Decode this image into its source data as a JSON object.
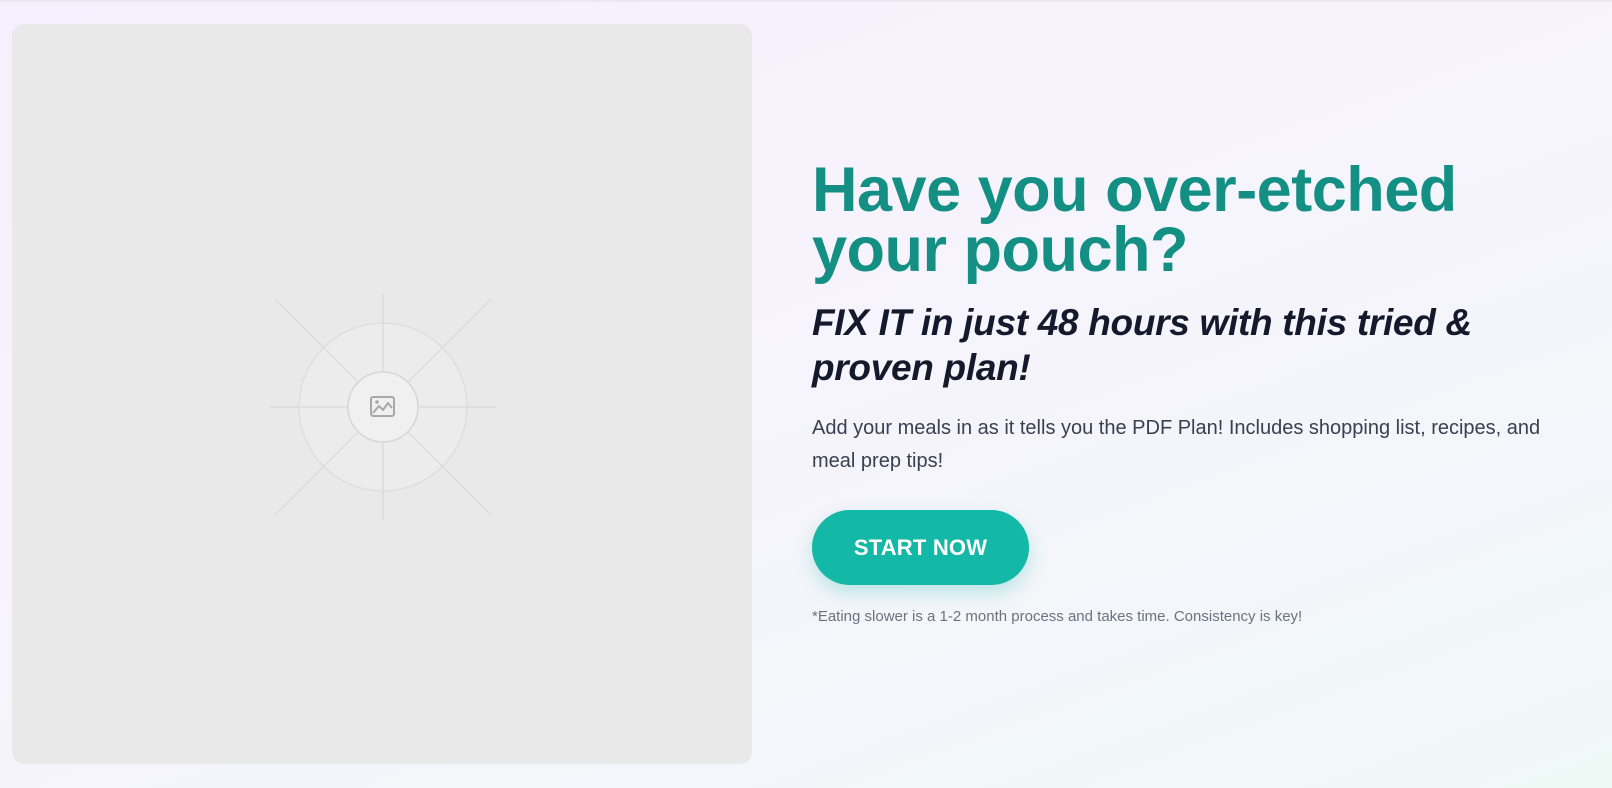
{
  "hero": {
    "image_placeholder": {
      "icon": "image-icon",
      "background_color": "#e9e9e9"
    },
    "headline": "Have you over-etched your pouch?",
    "subheadline": "FIX IT in just 48 hours with this tried & proven plan!",
    "description": "Add your meals in as it tells you the PDF Plan! Includes shopping list, recipes, and meal prep tips!",
    "cta_label": "START NOW",
    "disclaimer": "*Eating slower is a 1-2 month process and takes time. Consistency is key!"
  },
  "colors": {
    "headline": "#148f84",
    "subheadline": "#141a2b",
    "cta_background": "#14b8a6",
    "cta_text": "#ffffff",
    "body_text": "#374151",
    "disclaimer_text": "#6b7280"
  }
}
